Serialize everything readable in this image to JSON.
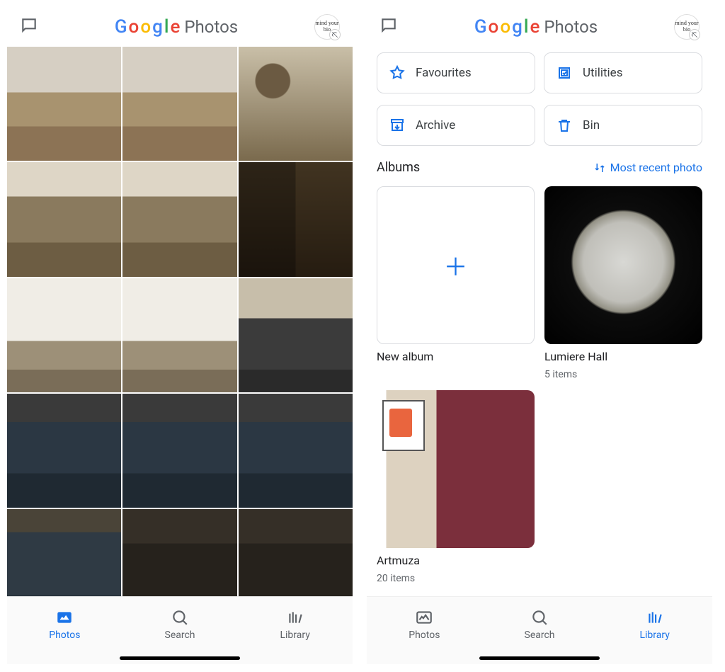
{
  "app": {
    "name_google": "Google",
    "name_photos": "Photos",
    "avatar_label": "mind your bio"
  },
  "left": {
    "nav": {
      "photos": "Photos",
      "search": "Search",
      "library": "Library",
      "active": "photos"
    }
  },
  "right": {
    "buttons": {
      "favourites": "Favourites",
      "utilities": "Utilities",
      "archive": "Archive",
      "bin": "Bin"
    },
    "albums_header": "Albums",
    "sort_label": "Most recent photo",
    "albums": [
      {
        "title": "New album",
        "subtitle": "",
        "type": "new"
      },
      {
        "title": "Lumiere Hall",
        "subtitle": "5 items",
        "type": "moon"
      },
      {
        "title": "Artmuza",
        "subtitle": "20 items",
        "type": "artmuza"
      }
    ],
    "nav": {
      "photos": "Photos",
      "search": "Search",
      "library": "Library",
      "active": "library"
    }
  }
}
